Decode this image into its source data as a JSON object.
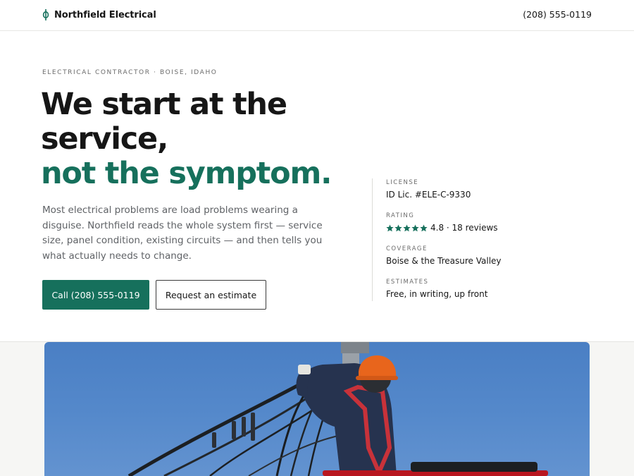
{
  "header": {
    "brand_name": "Northfield Electrical",
    "brand_icon": "phi-bolt-icon",
    "phone": "(208) 555-0119",
    "brand_color": "#16705c"
  },
  "hero": {
    "eyebrow": "ELECTRICAL CONTRACTOR · BOISE, IDAHO",
    "headline_line1": "We start at the",
    "headline_line2": "service,",
    "headline_accent": "not the symptom.",
    "lede": "Most electrical problems are load problems wearing a disguise. Northfield reads the whole system first — service size, panel condition, existing circuits — and then tells you what actually needs to change.",
    "primary_cta": "Call (208) 555-0119",
    "secondary_cta": "Request an estimate"
  },
  "facts": [
    {
      "label": "LICENSE",
      "value": "ID Lic. #ELE-C-9330"
    },
    {
      "label": "RATING",
      "value": "4.8 · 18 reviews",
      "stars": 5,
      "star_icon": "star-icon"
    },
    {
      "label": "COVERAGE",
      "value": "Boise & the Treasure Valley"
    },
    {
      "label": "ESTIMATES",
      "value": "Free, in writing, up front"
    }
  ],
  "photo": {
    "subject": "lineworker-on-utility-pole-photo"
  },
  "colors": {
    "accent": "#16705c",
    "text": "#161616",
    "muted": "#5f6266",
    "sky": "#4a7fc4"
  }
}
